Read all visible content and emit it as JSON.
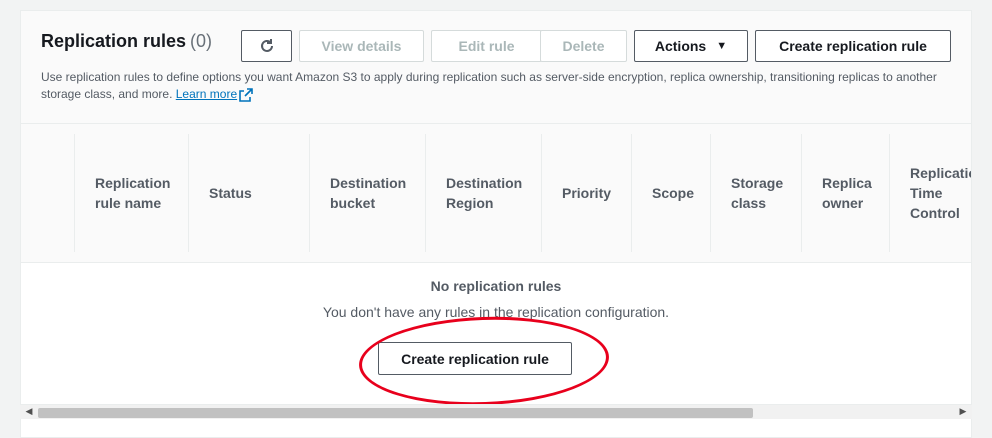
{
  "header": {
    "title": "Replication rules",
    "count": "(0)",
    "description": "Use replication rules to define options you want Amazon S3 to apply during replication such as server-side encryption, replica ownership, transitioning replicas to another storage class, and more.",
    "learn_more": "Learn more"
  },
  "toolbar": {
    "refresh_icon": "refresh-icon",
    "view_details": "View details",
    "edit_rule": "Edit rule",
    "delete": "Delete",
    "actions": "Actions",
    "create_rule": "Create replication rule"
  },
  "table": {
    "columns": [
      "Replication\nrule name",
      "Status",
      "Destination\nbucket",
      "Destination\nRegion",
      "Priority",
      "Scope",
      "Storage\nclass",
      "Replica\nowner",
      "Replication\nTime\nControl"
    ]
  },
  "empty_state": {
    "title": "No replication rules",
    "subtitle": "You don't have any rules in the replication configuration.",
    "button": "Create replication rule"
  },
  "colors": {
    "accent_link": "#0073bb",
    "annotation": "#e8001c"
  }
}
